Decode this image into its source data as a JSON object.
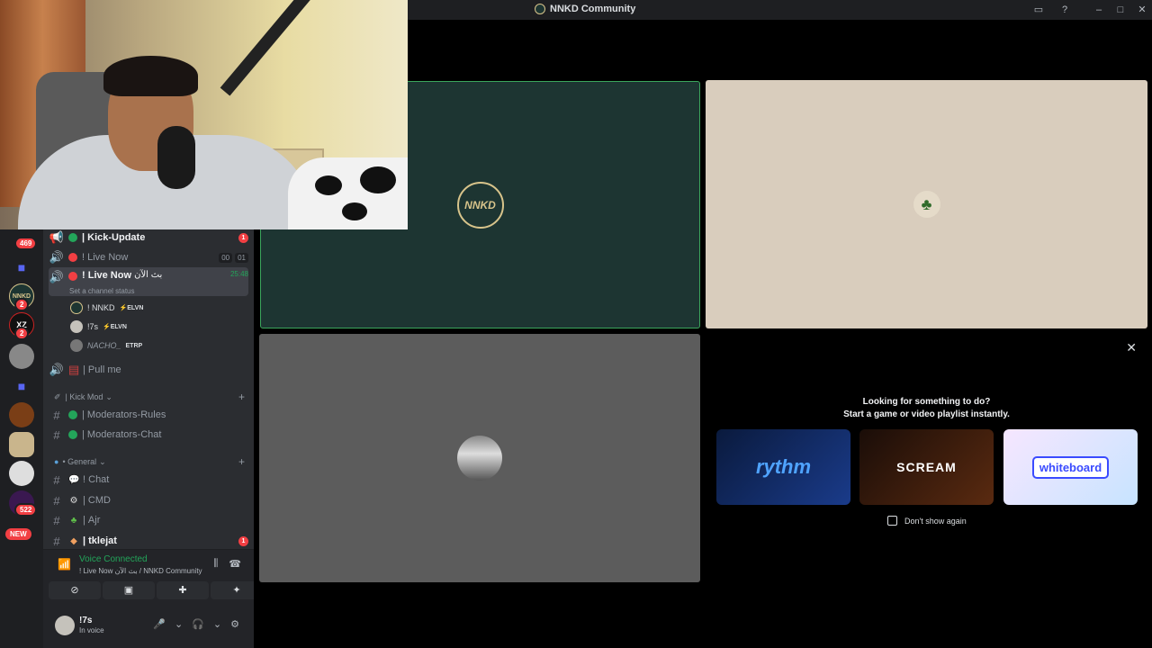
{
  "window": {
    "title": "NNKD Community"
  },
  "rail": {
    "badges": [
      "469",
      "2",
      "2",
      "522"
    ],
    "new_label": "NEW",
    "server_labels": [
      "NNKD",
      "XZ"
    ]
  },
  "channels": {
    "kick_update": {
      "prefix": "|",
      "name": "Kick-Update",
      "badge": "1"
    },
    "live_now_1": {
      "prefix": "!",
      "name": "Live Now",
      "counts": [
        "00",
        "01"
      ]
    },
    "live_now_2": {
      "prefix": "!",
      "name": "Live Now",
      "arabic": "بث الآن",
      "timer": "25:48",
      "status": "Set a channel status"
    },
    "voice_users": [
      {
        "name": "! NNKD",
        "tag": "⚡ELVN"
      },
      {
        "name": "!7s",
        "tag": "⚡ELVN"
      },
      {
        "name": "NACHO_",
        "tag": "ETRP"
      }
    ],
    "pull_me": {
      "prefix": "|",
      "name": "Pull me"
    },
    "cat_kick_mod": {
      "label": "| Kick Mod"
    },
    "moderators_rules": {
      "prefix": "|",
      "name": "Moderators-Rules"
    },
    "moderators_chat": {
      "prefix": "|",
      "name": "Moderators-Chat"
    },
    "cat_general": {
      "label": "• General"
    },
    "chat": {
      "prefix": "!",
      "name": "Chat"
    },
    "cmd": {
      "prefix": "|",
      "name": "CMD"
    },
    "ajr": {
      "prefix": "|",
      "name": "Ajr"
    },
    "tklejat": {
      "prefix": "|",
      "name": "tklejat",
      "badge": "1"
    }
  },
  "voice": {
    "status": "Voice Connected",
    "location": "! Live Now بث الآن / NNKD Community"
  },
  "user": {
    "name": "!7s",
    "status": "In voice"
  },
  "stage": {
    "nnkd_logo_text": "NNKD",
    "activity_title": "Looking for something to do?",
    "activity_subtitle": "Start a game or video playlist instantly.",
    "cards": [
      {
        "name": "rythm",
        "label": "rythm"
      },
      {
        "name": "scream",
        "label": "SCREAM"
      },
      {
        "name": "whiteboard",
        "label": "whiteboard"
      }
    ],
    "dont_show": "Don't show again"
  },
  "colors": {
    "accent_green": "#23a55a",
    "danger": "#f23f43",
    "blurple": "#5865f2"
  }
}
